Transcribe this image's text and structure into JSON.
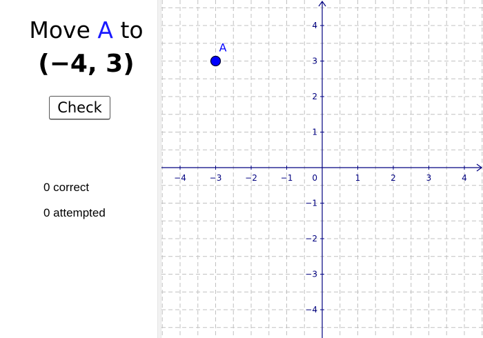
{
  "prompt": {
    "verb": "Move",
    "point_name": "A",
    "preposition": "to",
    "target": "(−4, 3)"
  },
  "check_button_label": "Check",
  "stats": {
    "correct_label": "0 correct",
    "attempted_label": "0 attempted"
  },
  "graph": {
    "x_ticks": [
      "−4",
      "−3",
      "−2",
      "−1",
      "1",
      "2",
      "3",
      "4"
    ],
    "y_ticks": [
      "4",
      "3",
      "2",
      "1",
      "−1",
      "−2",
      "−3",
      "−4"
    ],
    "origin_label": "0",
    "axis_color": "#000080",
    "grid_color": "#c0c0c0",
    "point": {
      "name": "A",
      "x": -3,
      "y": 3,
      "color": "#0000ff"
    }
  }
}
